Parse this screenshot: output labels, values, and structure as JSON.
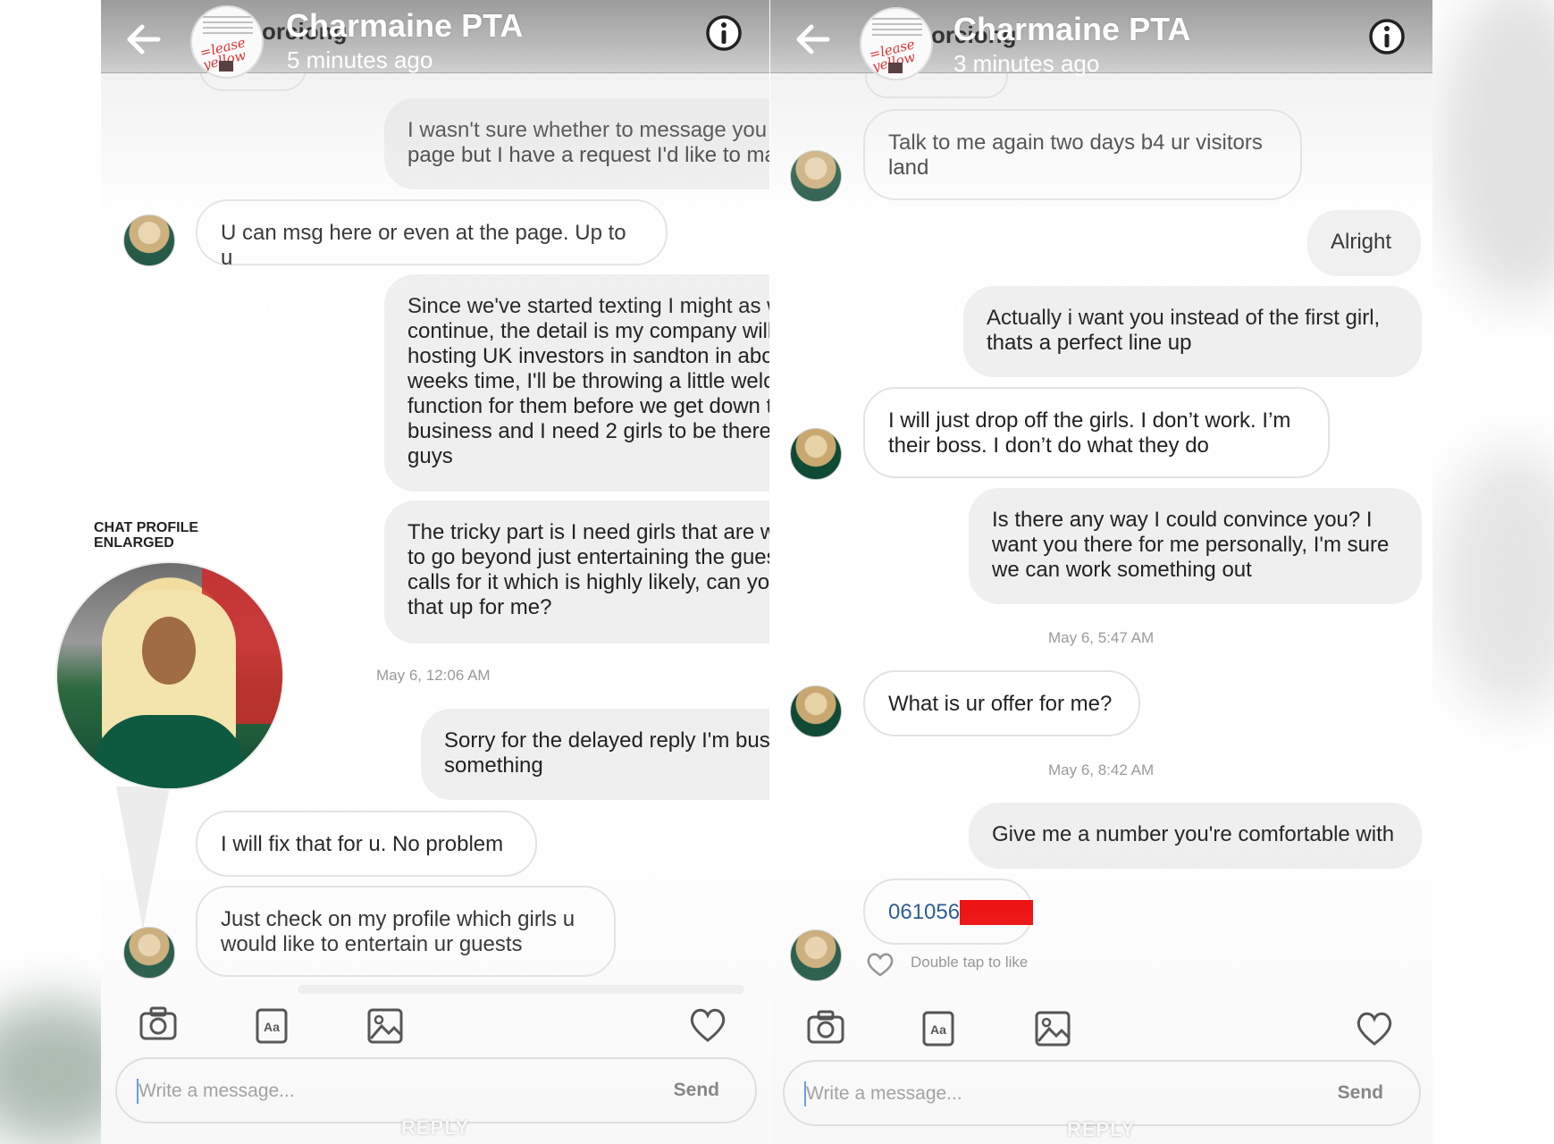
{
  "left_chat": {
    "header": {
      "title": "Charmaine PTA",
      "subtitle": "5 minutes ago",
      "under_text": "orciong"
    },
    "messages": [
      {
        "dir": "out",
        "text": "I wasn't sure whether to message you or the page but I have a request I'd like to make"
      },
      {
        "dir": "in",
        "text": "U can msg here or even at the page. Up to u"
      },
      {
        "dir": "out",
        "text": "Since we've started texting I might as well continue, the detail is my company will be hosting UK investors in sandton in about 2 weeks time, I'll be throwing a little welcome function for them before we get down to business and I need 2 girls to be there, it's 2 guys"
      },
      {
        "dir": "out",
        "text": "The tricky part is I need girls that are willing to go beyond just entertaining the guests if it calls for it which is highly likely, can you fix that up for me?"
      },
      {
        "dir": "timestamp",
        "text": "May 6, 12:06 AM"
      },
      {
        "dir": "out",
        "text": "Sorry for the delayed reply I'm busy with something"
      },
      {
        "dir": "in",
        "text": "I will fix that for u. No problem"
      },
      {
        "dir": "in",
        "text": "Just check on my profile which girls u would like to entertain ur guests"
      }
    ],
    "composer": {
      "placeholder": "Write a message...",
      "send": "Send",
      "reply": "REPLY"
    }
  },
  "right_chat": {
    "header": {
      "title": "Charmaine PTA",
      "subtitle": "3 minutes ago",
      "under_text": "orciong"
    },
    "messages": [
      {
        "dir": "in",
        "text": "Talk to me again two days b4 ur visitors land"
      },
      {
        "dir": "out",
        "text": "Alright"
      },
      {
        "dir": "out",
        "text": "Actually i want you instead of the first girl, thats a perfect line up"
      },
      {
        "dir": "in",
        "text": "I will just drop off the girls. I don’t work. I’m their boss. I don’t do what they do"
      },
      {
        "dir": "out",
        "text": "Is there any way I could convince you? I want you there for me personally, I'm sure we can work something out"
      },
      {
        "dir": "timestamp",
        "text": "May 6, 5:47 AM"
      },
      {
        "dir": "in",
        "text": "What is ur offer for me?"
      },
      {
        "dir": "timestamp",
        "text": "May 6, 8:42 AM"
      },
      {
        "dir": "out",
        "text": "Give me a number you're comfortable with"
      },
      {
        "dir": "in",
        "text": "061056"
      }
    ],
    "like_hint": "Double tap to like",
    "composer": {
      "placeholder": "Write a message...",
      "send": "Send",
      "reply": "REPLY"
    }
  },
  "overlay": {
    "label_line1": "CHAT PROFILE",
    "label_line2": "ENLARGED"
  },
  "colors": {
    "redaction": "#ee0000",
    "bubble_out": "#efefef",
    "bubble_in_border": "#e3e3e3",
    "phone_number": "#1a4f8c"
  }
}
